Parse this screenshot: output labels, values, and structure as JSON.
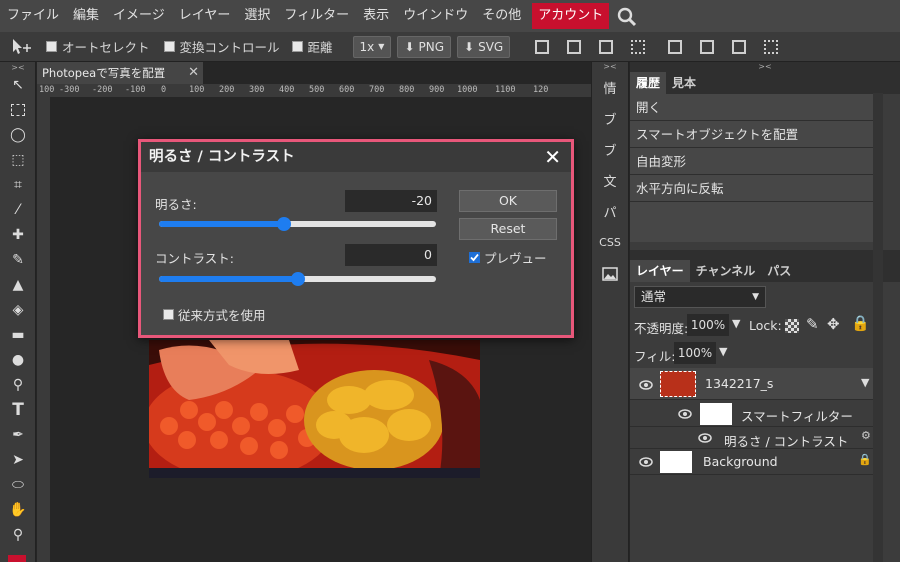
{
  "menubar": {
    "items": [
      "ファイル",
      "編集",
      "イメージ",
      "レイヤー",
      "選択",
      "フィルター",
      "表示",
      "ウインドウ",
      "その他"
    ],
    "account": "アカウント"
  },
  "options": {
    "auto_select": "オートセレクト",
    "transform_controls": "変換コントロール",
    "distance": "距離",
    "scale": "1x",
    "png": "PNG",
    "svg": "SVG"
  },
  "document": {
    "tab_title": "Photopeaで写真を配置",
    "ruler_ticks": [
      "100",
      "-300",
      "-200",
      "-100",
      "0",
      "100",
      "200",
      "300",
      "400",
      "500",
      "600",
      "700",
      "800",
      "900",
      "1000",
      "1100",
      "120"
    ]
  },
  "narrow_panel": {
    "items": [
      "情",
      "ブ",
      "ブ",
      "文",
      "パ",
      "CSS"
    ]
  },
  "history": {
    "tabs": [
      "履歴",
      "見本"
    ],
    "items": [
      "開く",
      "スマートオブジェクトを配置",
      "自由変形",
      "水平方向に反転"
    ]
  },
  "layers": {
    "tabs": [
      "レイヤー",
      "チャンネル",
      "パス"
    ],
    "blend_mode": "通常",
    "opacity_label": "不透明度:",
    "opacity_value": "100%",
    "lock_label": "Lock:",
    "fill_label": "フィル:",
    "fill_value": "100%",
    "items": [
      {
        "name": "1342217_s"
      },
      {
        "name": "スマートフィルター"
      },
      {
        "name": "明るさ / コントラスト"
      },
      {
        "name": "Background"
      }
    ]
  },
  "dialog": {
    "title": "明るさ / コントラスト",
    "brightness_label": "明るさ:",
    "brightness_value": "-20",
    "brightness_slider": 0.45,
    "contrast_label": "コントラスト:",
    "contrast_value": "0",
    "contrast_slider": 0.5,
    "ok": "OK",
    "reset": "Reset",
    "preview": "プレヴュー",
    "legacy": "従来方式を使用"
  },
  "colors": {
    "accent_blue": "#1e7df0",
    "dialog_border": "#e8577a",
    "account_red": "#c8102e"
  }
}
